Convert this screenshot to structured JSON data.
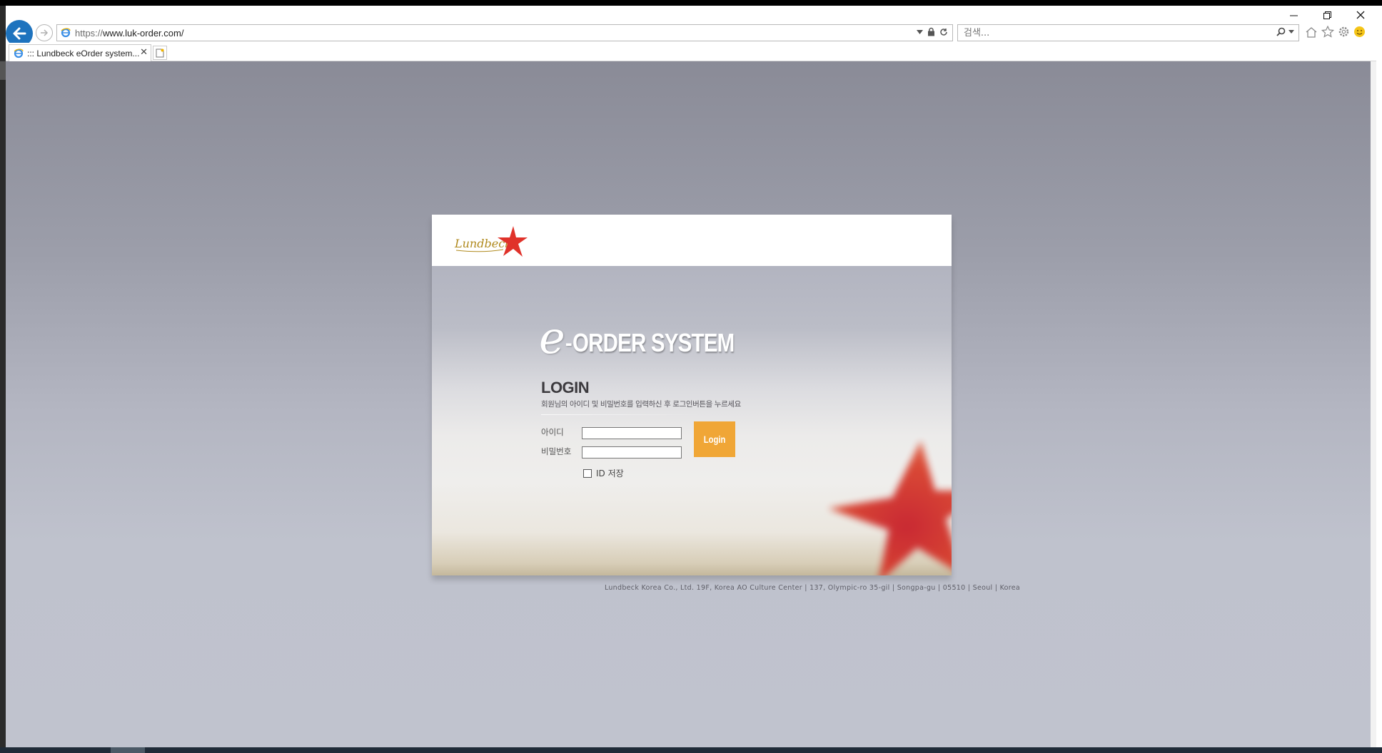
{
  "browser": {
    "url_protocol": "https://",
    "url_rest": "www.luk-order.com/",
    "search_placeholder": "검색...",
    "tab_title": "::: Lundbeck eOrder system...",
    "tab_close": "✕"
  },
  "page": {
    "logo_text": "Lundbeck",
    "eorder_e": "e",
    "eorder_dash": "-",
    "eorder_text": "ORDER SYSTEM",
    "login_title": "LOGIN",
    "login_desc": "회원님의 아이디 및 비밀번호를 입력하신 후 로그인버튼을 누르세요",
    "id_label": "아이디",
    "pw_label": "비밀번호",
    "login_button": "Login",
    "save_id_label": "ID 저장",
    "footer": "Lundbeck Korea Co., Ltd. 19F, Korea AO Culture Center  |  137, Olympic-ro 35-gil  |  Songpa-gu  |  05510  |  Seoul  |  Korea"
  },
  "colors": {
    "accent_button": "#f0a636",
    "back_button": "#1e73be",
    "logo_star": "#e0322a",
    "logo_text": "#b08a1e"
  }
}
